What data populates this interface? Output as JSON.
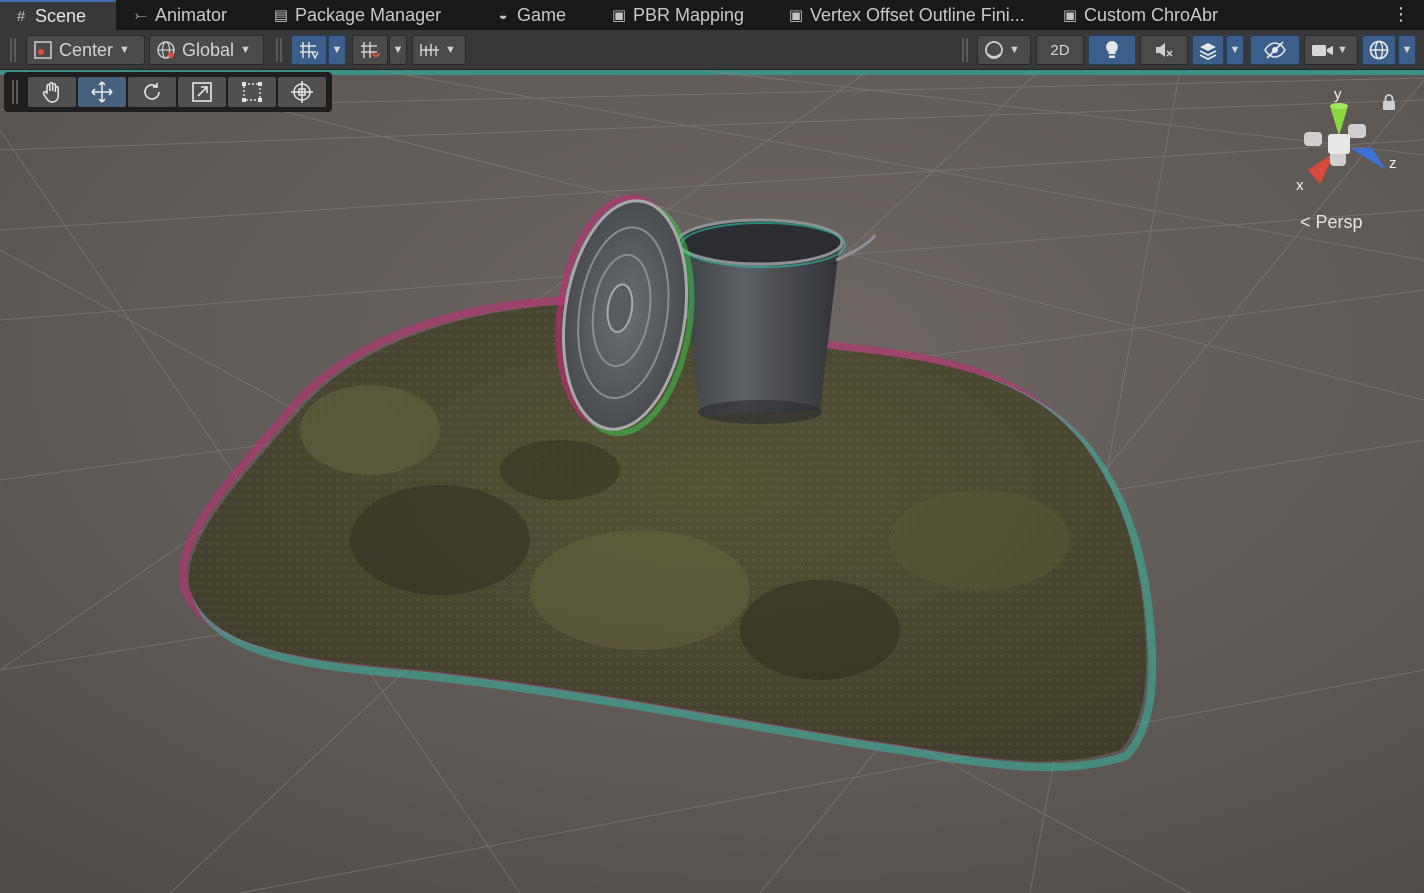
{
  "tabs": [
    {
      "label": "Scene",
      "icon": "hash-icon"
    },
    {
      "label": "Animator",
      "icon": "animator-icon"
    },
    {
      "label": "Package Manager",
      "icon": "package-icon"
    },
    {
      "label": "Game",
      "icon": "gamepad-icon"
    },
    {
      "label": "PBR Mapping",
      "icon": "lock-icon"
    },
    {
      "label": "Vertex Offset Outline Fini...",
      "icon": "lock-icon"
    },
    {
      "label": "Custom ChroAbr",
      "icon": "lock-icon"
    }
  ],
  "toolbar": {
    "pivot_mode": "Center",
    "pivot_rotation": "Global",
    "toggle_2d": "2D"
  },
  "tool_palette": [
    "hand-tool",
    "move-tool",
    "rotate-tool",
    "scale-tool",
    "rect-tool",
    "transform-tool"
  ],
  "gizmo": {
    "axis_y": "y",
    "axis_x": "x",
    "axis_z": "z",
    "projection": "Persp"
  },
  "colors": {
    "selected": "#3b5f8a",
    "x_axis": "#d84a3c",
    "y_axis": "#8ad83f",
    "z_axis": "#3f72d8",
    "ground": "#5c5652"
  }
}
